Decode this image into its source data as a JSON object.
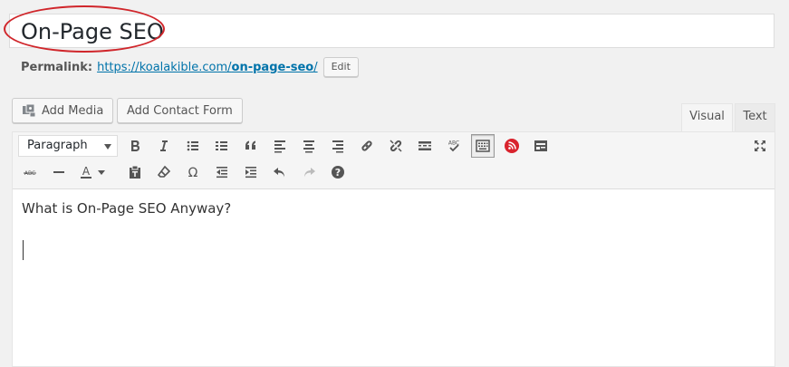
{
  "post": {
    "title": "On-Page SEO",
    "content": "What is On-Page SEO Anyway?"
  },
  "permalink": {
    "label": "Permalink:",
    "url_prefix": "https://koalakible.com/",
    "slug": "on-page-seo",
    "url_suffix": "/",
    "edit_label": "Edit"
  },
  "media": {
    "add_media_label": "Add Media",
    "add_contact_form_label": "Add Contact Form"
  },
  "tabs": {
    "visual_label": "Visual",
    "text_label": "Text"
  },
  "toolbar": {
    "format_value": "Paragraph",
    "row1_icons": [
      "bold-icon",
      "italic-icon",
      "bulleted-list-icon",
      "numbered-list-icon",
      "blockquote-icon",
      "align-left-icon",
      "align-center-icon",
      "align-right-icon",
      "insert-link-icon",
      "remove-link-icon",
      "read-more-icon",
      "spellcheck-icon",
      "toolbar-toggle-icon",
      "plugin-rss-icon",
      "insert-form-icon",
      "fullscreen-icon"
    ],
    "row2_icons": [
      "strikethrough-icon",
      "horizontal-line-icon",
      "text-color-icon",
      "paste-as-text-icon",
      "clear-formatting-icon",
      "special-character-icon",
      "decrease-indent-icon",
      "increase-indent-icon",
      "undo-icon",
      "redo-icon",
      "help-icon"
    ],
    "spellcheck_glyph": "ABC",
    "strikethrough_glyph": "ABC",
    "text_color_glyph": "A",
    "omega_glyph": "Ω",
    "help_glyph": "?"
  },
  "colors": {
    "link": "#0073aa",
    "highlight_oval": "#d0262b",
    "plugin_icon": "#d9232d"
  }
}
